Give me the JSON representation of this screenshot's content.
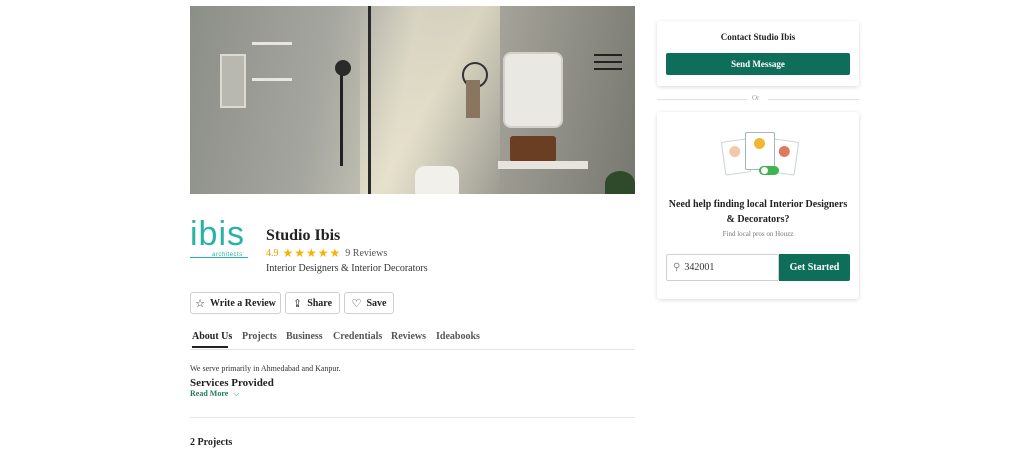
{
  "profile": {
    "logo_word": "ibis",
    "logo_sub": "architects",
    "name": "Studio Ibis",
    "rating": "4.9",
    "stars": "★★★★★",
    "reviews": "9 Reviews",
    "category": "Interior Designers & Interior Decorators"
  },
  "actions": {
    "write_review": "Write a Review",
    "share": "Share",
    "save": "Save"
  },
  "tabs": [
    {
      "label": "About Us"
    },
    {
      "label": "Projects"
    },
    {
      "label": "Business"
    },
    {
      "label": "Credentials"
    },
    {
      "label": "Reviews"
    },
    {
      "label": "Ideabooks"
    }
  ],
  "about": {
    "text": "We serve primarily in Ahmedabad and Kanpur.",
    "services_heading": "Services Provided",
    "read_more": "Read More"
  },
  "projects_heading": "2 Projects",
  "contact": {
    "title": "Contact Studio Ibis",
    "send_message": "Send Message",
    "or": "Or"
  },
  "finder": {
    "headline_line1": "Need help finding local Interior Designers",
    "headline_line2": "& Decorators?",
    "subline": "Find local pros on Houzz",
    "zip_value": "342001",
    "get_started": "Get Started"
  },
  "colors": {
    "brand_green": "#0f6e5a",
    "logo_teal": "#28b3a7",
    "star_gold": "#f5b400"
  }
}
